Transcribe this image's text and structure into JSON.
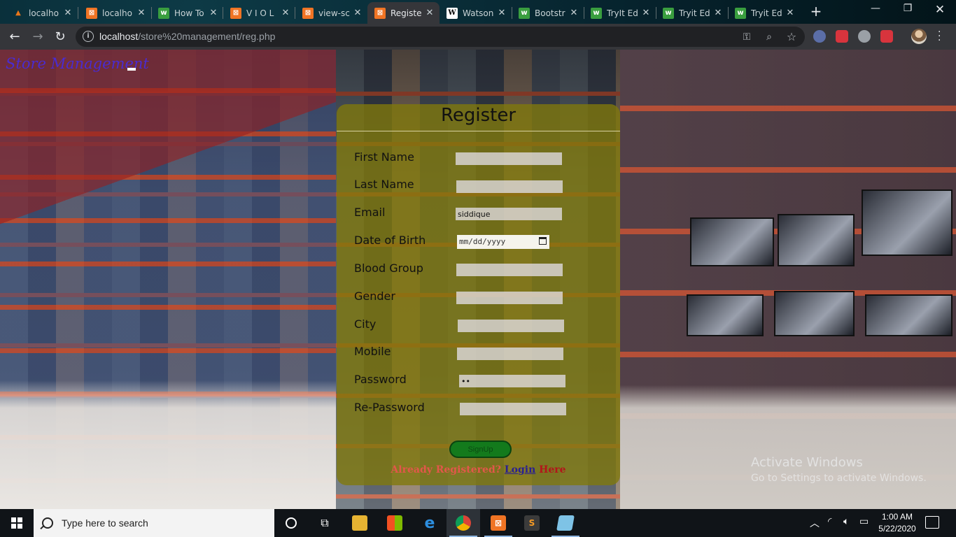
{
  "browser": {
    "tabs": [
      {
        "title": "localho",
        "favicon": "xampp-cone-icon",
        "color": "#e8761a"
      },
      {
        "title": "localho",
        "favicon": "xampp-icon",
        "color": "#f07424"
      },
      {
        "title": "How To",
        "favicon": "w3schools-icon",
        "color": "#3a9e3f"
      },
      {
        "title": "V I O L",
        "favicon": "xampp-icon",
        "color": "#f07424"
      },
      {
        "title": "view-sc",
        "favicon": "xampp-icon",
        "color": "#f07424"
      },
      {
        "title": "Registe",
        "favicon": "xampp-icon",
        "color": "#f07424",
        "active": true
      },
      {
        "title": "Watson",
        "favicon": "wikipedia-icon",
        "color": "#ffffff"
      },
      {
        "title": "Bootstr",
        "favicon": "w3schools-icon",
        "color": "#3a9e3f"
      },
      {
        "title": "TryIt Ed",
        "favicon": "w3schools-icon",
        "color": "#3a9e3f"
      },
      {
        "title": "Tryit Ed",
        "favicon": "w3schools-icon",
        "color": "#3a9e3f"
      },
      {
        "title": "Tryit Ed",
        "favicon": "w3schools-icon",
        "color": "#3a9e3f"
      }
    ],
    "url_host": "localhost",
    "url_path": "/store%20management/reg.php"
  },
  "page": {
    "brand": "Store Management",
    "form": {
      "title": "Register",
      "fields": [
        {
          "label": "First Name",
          "value": ""
        },
        {
          "label": "Last Name",
          "value": ""
        },
        {
          "label": "Email",
          "value": "siddique"
        },
        {
          "label": "Date of Birth",
          "value": "mm/dd/yyyy"
        },
        {
          "label": "Blood Group",
          "value": ""
        },
        {
          "label": "Gender",
          "value": ""
        },
        {
          "label": "City",
          "value": ""
        },
        {
          "label": "Mobile",
          "value": ""
        },
        {
          "label": "Password",
          "value": "••"
        },
        {
          "label": "Re-Password",
          "value": ""
        }
      ],
      "submit_label": "SignUp",
      "already_text": "Already Registered?",
      "login_text": "Login",
      "here_text": "Here"
    },
    "watermark": {
      "line1": "Activate Windows",
      "line2": "Go to Settings to activate Windows."
    }
  },
  "taskbar": {
    "search_placeholder": "Type here to search",
    "time": "1:00 AM",
    "date": "5/22/2020"
  },
  "colors": {
    "card": "#807a0a",
    "brand": "#4a2bd1",
    "submit": "#137a1c",
    "already": "#e2574a",
    "login": "#2a2090",
    "here": "#b3151a"
  }
}
